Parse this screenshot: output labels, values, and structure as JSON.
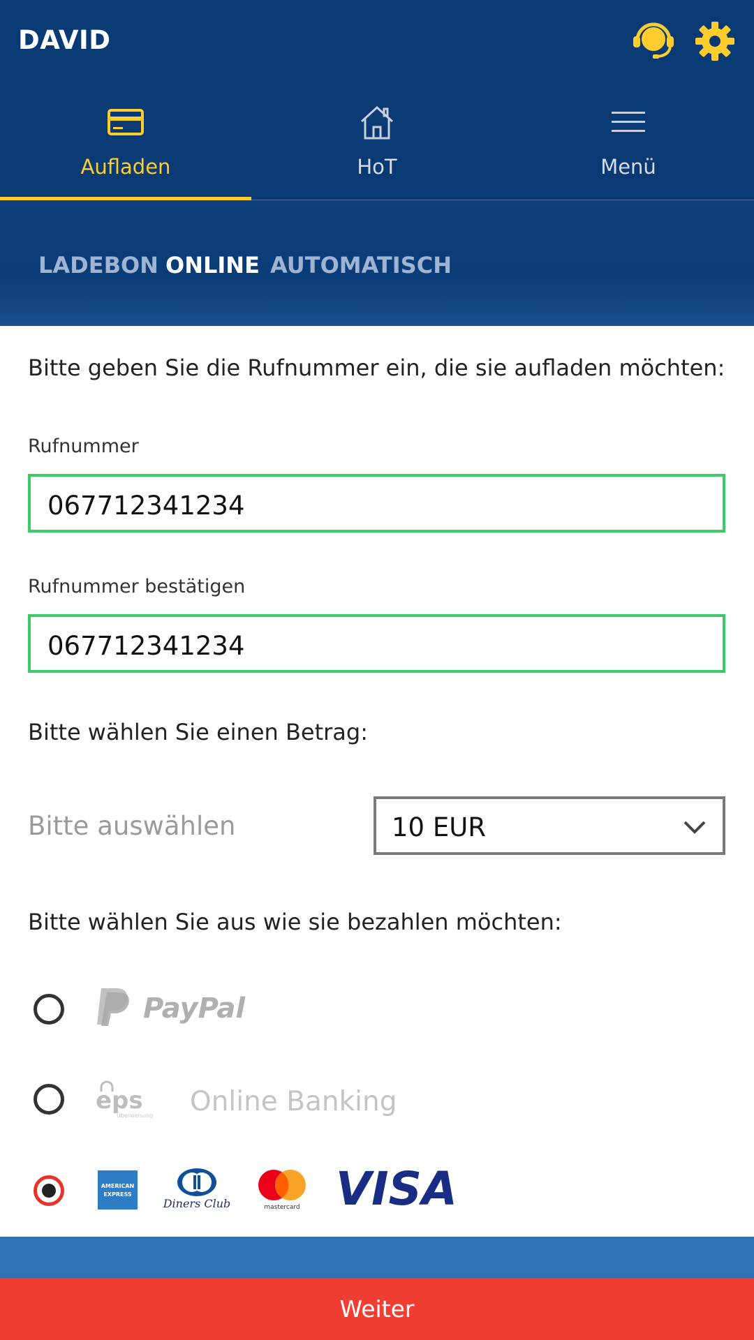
{
  "header": {
    "app_title": "DAVID",
    "icons": {
      "support": "headset-icon",
      "settings": "gear-icon"
    },
    "accent_color": "#ffcd2e",
    "background_color": "#0a3a73"
  },
  "nav": {
    "tabs": [
      {
        "label": "Aufladen",
        "icon": "card-icon",
        "active": true
      },
      {
        "label": "HoT",
        "icon": "home-icon",
        "active": false
      },
      {
        "label": "Menü",
        "icon": "hamburger-icon",
        "active": false
      }
    ]
  },
  "subtabs": [
    {
      "label": "LADEBON",
      "active": false
    },
    {
      "label": "ONLINE",
      "active": true
    },
    {
      "label": "AUTOMATISCH",
      "active": false
    }
  ],
  "form": {
    "intro": "Bitte geben Sie die Rufnummer ein, die sie aufladen möchten:",
    "phone_label": "Rufnummer",
    "phone_value": "067712341234",
    "confirm_label": "Rufnummer bestätigen",
    "confirm_value": "067712341234",
    "valid_border_color": "#3cc96a",
    "amount_title": "Bitte wählen Sie einen Betrag:",
    "amount_hint": "Bitte auswählen",
    "amount_selected": "10 EUR",
    "payment_title": "Bitte wählen Sie aus wie sie bezahlen möchten:"
  },
  "payment": {
    "options": [
      {
        "id": "paypal",
        "logo_text": "PayPal",
        "selected": false
      },
      {
        "id": "eps",
        "logo_text": "eps",
        "logo_subtext": "Überweisung",
        "label": "Online Banking",
        "selected": false
      },
      {
        "id": "cards",
        "selected": true,
        "logos": [
          {
            "name": "amex",
            "text1": "AMERICAN",
            "text2": "EXPRESS"
          },
          {
            "name": "diners",
            "text": "Diners Club"
          },
          {
            "name": "mastercard",
            "text": "mastercard"
          },
          {
            "name": "visa",
            "text": "VISA"
          }
        ]
      }
    ]
  },
  "footer": {
    "button_label": "Weiter",
    "button_color": "#f03e32",
    "strip_color": "#2f73b7"
  }
}
